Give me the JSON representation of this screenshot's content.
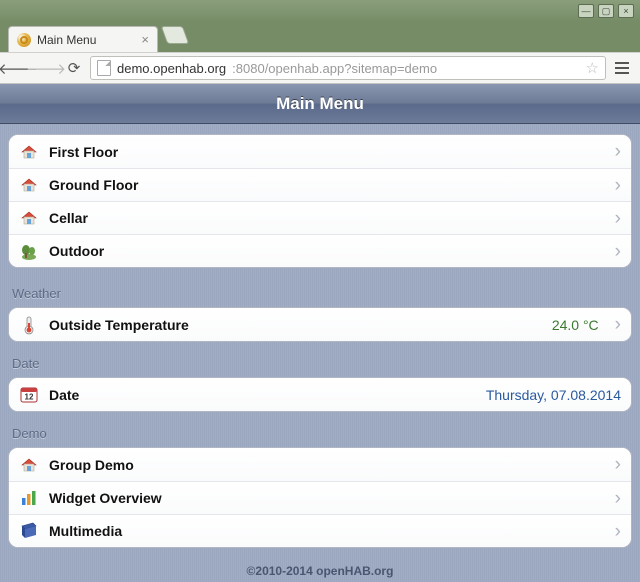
{
  "browser": {
    "tab_title": "Main Menu",
    "url_host": "demo.openhab.org",
    "url_path": ":8080/openhab.app?sitemap=demo"
  },
  "header": {
    "title": "Main Menu"
  },
  "sections": [
    {
      "header": null,
      "rows": [
        {
          "icon": "floor",
          "label": "First Floor",
          "value": null,
          "chevron": true
        },
        {
          "icon": "floor",
          "label": "Ground Floor",
          "value": null,
          "chevron": true
        },
        {
          "icon": "floor",
          "label": "Cellar",
          "value": null,
          "chevron": true
        },
        {
          "icon": "outdoor",
          "label": "Outdoor",
          "value": null,
          "chevron": true
        }
      ]
    },
    {
      "header": "Weather",
      "rows": [
        {
          "icon": "thermo",
          "label": "Outside Temperature",
          "value": "24.0 °C",
          "value_style": "green",
          "chevron": true
        }
      ]
    },
    {
      "header": "Date",
      "rows": [
        {
          "icon": "calendar",
          "label": "Date",
          "value": "Thursday, 07.08.2014",
          "value_style": "blue",
          "chevron": false
        }
      ]
    },
    {
      "header": "Demo",
      "rows": [
        {
          "icon": "floor",
          "label": "Group Demo",
          "value": null,
          "chevron": true
        },
        {
          "icon": "chart",
          "label": "Widget Overview",
          "value": null,
          "chevron": true
        },
        {
          "icon": "media",
          "label": "Multimedia",
          "value": null,
          "chevron": true
        }
      ]
    }
  ],
  "footer": "©2010-2014 openHAB.org"
}
